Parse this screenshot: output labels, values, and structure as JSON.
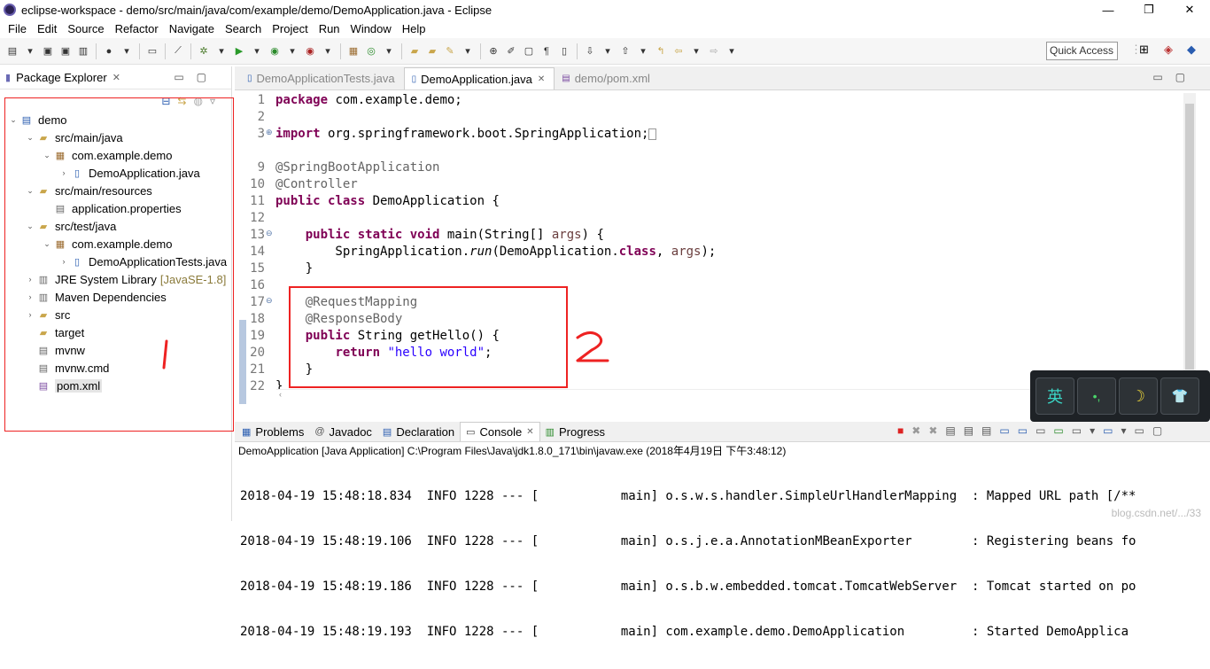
{
  "window": {
    "title": "eclipse-workspace - demo/src/main/java/com/example/demo/DemoApplication.java - Eclipse",
    "minimize": "—",
    "maximize": "❐",
    "close": "✕"
  },
  "menu": [
    "File",
    "Edit",
    "Source",
    "Refactor",
    "Navigate",
    "Search",
    "Project",
    "Run",
    "Window",
    "Help"
  ],
  "quick_access": "Quick Access",
  "package_explorer": {
    "tab_label": "Package Explorer",
    "tree": [
      {
        "label": "demo",
        "icon": "project-icon"
      },
      {
        "label": "src/main/java",
        "icon": "source-folder-icon"
      },
      {
        "label": "com.example.demo",
        "icon": "package-icon"
      },
      {
        "label": "DemoApplication.java",
        "icon": "java-file-icon"
      },
      {
        "label": "src/main/resources",
        "icon": "source-folder-icon"
      },
      {
        "label": "application.properties",
        "icon": "file-icon"
      },
      {
        "label": "src/test/java",
        "icon": "source-folder-icon"
      },
      {
        "label": "com.example.demo",
        "icon": "package-icon"
      },
      {
        "label": "DemoApplicationTests.java",
        "icon": "java-file-icon"
      },
      {
        "label": "JRE System Library",
        "suffix": "[JavaSE-1.8]",
        "icon": "library-icon"
      },
      {
        "label": "Maven Dependencies",
        "icon": "library-icon"
      },
      {
        "label": "src",
        "icon": "folder-icon"
      },
      {
        "label": "target",
        "icon": "folder-icon"
      },
      {
        "label": "mvnw",
        "icon": "file-icon"
      },
      {
        "label": "mvnw.cmd",
        "icon": "file-icon"
      },
      {
        "label": "pom.xml",
        "icon": "xml-file-icon"
      }
    ]
  },
  "editor": {
    "tabs": [
      {
        "label": "DemoApplicationTests.java"
      },
      {
        "label": "DemoApplication.java"
      },
      {
        "label": "demo/pom.xml"
      }
    ],
    "line_numbers": [
      "1",
      "2",
      "3",
      "9",
      "10",
      "11",
      "12",
      "13",
      "14",
      "15",
      "16",
      "17",
      "18",
      "19",
      "20",
      "21",
      "22"
    ],
    "code": {
      "l1_kw": "package",
      "l1_rest": " com.example.demo;",
      "l3_kw": "import",
      "l3_rest": " org.springframework.boot.SpringApplication;",
      "l9": "@SpringBootApplication",
      "l10": "@Controller",
      "l11_kw1": "public",
      "l11_kw2": "class",
      "l11_rest": " DemoApplication {",
      "l13_kw": "public static void",
      "l13_a": " main(String[] ",
      "l13_var": "args",
      "l13_b": ") {",
      "l14_a": "        SpringApplication.",
      "l14_run": "run",
      "l14_b": "(DemoApplication.",
      "l14_kw": "class",
      "l14_c": ", ",
      "l14_var": "args",
      "l14_d": ");",
      "l15": "    }",
      "l17": "    @RequestMapping",
      "l18": "    @ResponseBody",
      "l19_kw": "public",
      "l19_rest": " String getHello() {",
      "l20_kw": "return",
      "l20_str": "\"hello world\"",
      "l20_end": ";",
      "l21": "    }",
      "l22": "}"
    }
  },
  "ime": {
    "lang": "英",
    "punct": "•,",
    "moon": "☽",
    "shirt": "👕"
  },
  "console": {
    "tabs": [
      {
        "label": "Problems"
      },
      {
        "label": "Javadoc"
      },
      {
        "label": "Declaration"
      },
      {
        "label": "Console"
      },
      {
        "label": "Progress"
      }
    ],
    "description": "DemoApplication [Java Application] C:\\Program Files\\Java\\jdk1.8.0_171\\bin\\javaw.exe (2018年4月19日 下午3:48:12)",
    "lines": [
      "2018-04-19 15:48:18.834  INFO 1228 --- [           main] o.s.w.s.handler.SimpleUrlHandlerMapping  : Mapped URL path [/**",
      "2018-04-19 15:48:19.106  INFO 1228 --- [           main] o.s.j.e.a.AnnotationMBeanExporter        : Registering beans fo",
      "2018-04-19 15:48:19.186  INFO 1228 --- [           main] o.s.b.w.embedded.tomcat.TomcatWebServer  : Tomcat started on po",
      "2018-04-19 15:48:19.193  INFO 1228 --- [           main] com.example.demo.DemoApplication         : Started DemoApplica"
    ],
    "watermark": "blog.csdn.net/.../33"
  }
}
